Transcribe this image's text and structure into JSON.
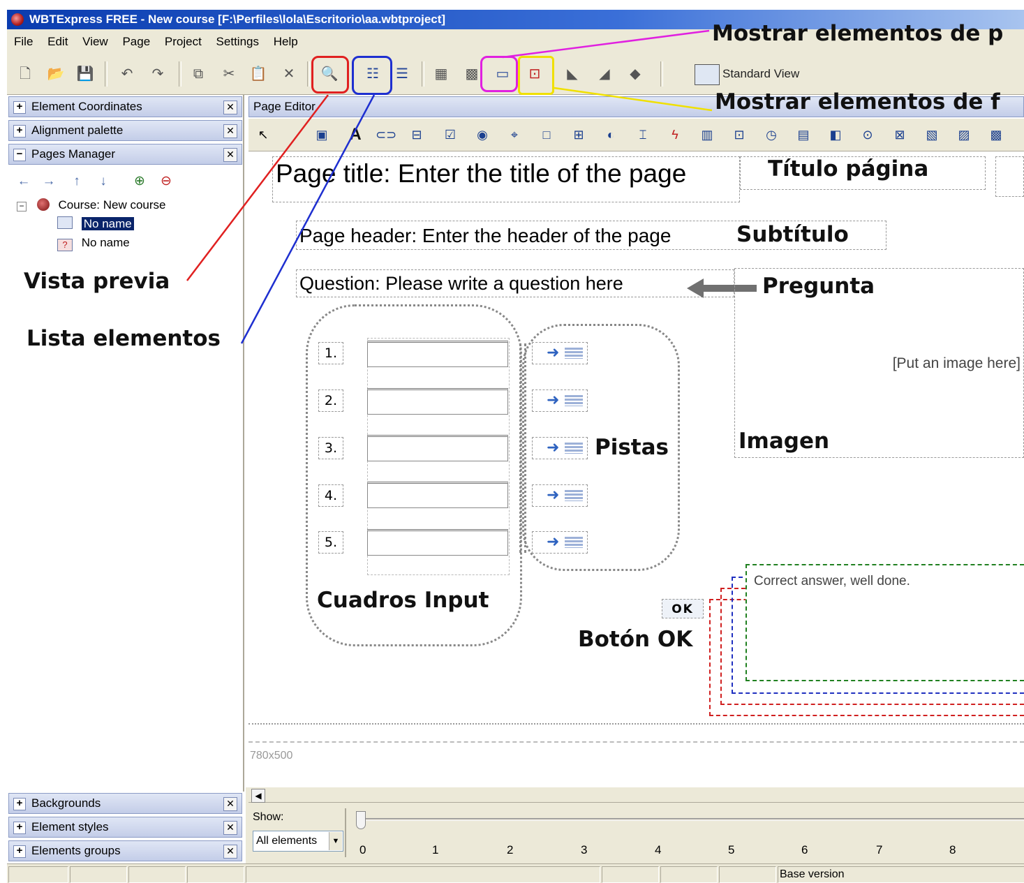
{
  "window": {
    "title": "WBTExpress FREE - New course [F:\\Perfiles\\lola\\Escritorio\\aa.wbtproject]"
  },
  "menu": [
    "File",
    "Edit",
    "View",
    "Page",
    "Project",
    "Settings",
    "Help"
  ],
  "toolbar": {
    "standard_view": "Standard View"
  },
  "left_panels": {
    "element_coordinates": "Element Coordinates",
    "alignment_palette": "Alignment palette",
    "pages_manager": "Pages Manager",
    "backgrounds": "Backgrounds",
    "element_styles": "Element styles",
    "elements_groups": "Elements groups"
  },
  "tree": {
    "course": "Course: New course",
    "page1": "No name",
    "page2": "No name"
  },
  "editor": {
    "header": "Page Editor",
    "page_title": "Page title: Enter the title of the page",
    "page_header": "Page header: Enter the header of the page",
    "question": "Question: Please write a question here",
    "image_placeholder": "[Put an image here]",
    "numbers": [
      "1.",
      "2.",
      "3.",
      "4.",
      "5."
    ],
    "ok_button": "OK",
    "feedback": "Correct answer, well done.",
    "size": "780x500"
  },
  "annotations": {
    "titulo_pagina": "Título página",
    "subtitulo": "Subtítulo",
    "pregunta": "Pregunta",
    "imagen": "Imagen",
    "pistas": "Pistas",
    "cuadros_input": "Cuadros Input",
    "boton_ok": "Botón OK",
    "vista_previa": "Vista previa",
    "lista_elementos": "Lista elementos",
    "mostrar_1": "Mostrar elementos de p",
    "mostrar_2": "Mostrar elementos de f"
  },
  "show": {
    "label": "Show:",
    "value": "All elements",
    "ticks": [
      "0",
      "1",
      "2",
      "3",
      "4",
      "5",
      "6",
      "7",
      "8"
    ]
  },
  "status": {
    "version": "Base version"
  },
  "colors": {
    "preview_box": "#e02020",
    "list_box": "#1e2fd0",
    "pink_box": "#e020e0",
    "yellow_box": "#f0e000"
  }
}
